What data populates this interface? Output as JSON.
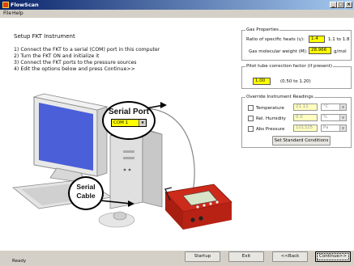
{
  "window": {
    "title": "FlowScan",
    "minimize": "_",
    "maximize": "□",
    "close": "×"
  },
  "menu": {
    "file": "File",
    "help": "Help"
  },
  "setup": {
    "heading": "Setup FKT Instrument",
    "steps": [
      "1) Connect the FKT to a serial (COM) port in this computer",
      "2) Turn the FKT ON and initialize it",
      "3) Connect the FKT ports to the pressure sources",
      "4) Edit the options below and press Continue>>"
    ]
  },
  "illustration": {
    "serial_port_label": "Serial Port",
    "com_port_value": "COM 1",
    "serial_cable_label_line1": "Serial",
    "serial_cable_label_line2": "Cable"
  },
  "gas_properties": {
    "title": "Gas Properties",
    "ratio_label": "Ratio of specific heats (γ):",
    "ratio_value": "1.4",
    "ratio_range": "1.1 to 1.8",
    "weight_label": "Gas molecular weight (M):",
    "weight_value": "28.966",
    "weight_unit": "g/mol"
  },
  "pitot": {
    "title": "Pitot tube correction factor (if present)",
    "value": "1.00",
    "range": "(0.50 to 1.20)"
  },
  "override": {
    "title": "Override Instrument Readings",
    "temperature_label": "Temperature",
    "temperature_value": "21.11",
    "temperature_unit": "°C",
    "humidity_label": "Rel. Humidity",
    "humidity_value": "0.0",
    "humidity_unit": "%",
    "pressure_label": "Abs Pressure",
    "pressure_value": "101325",
    "pressure_unit": "Pa",
    "set_standard_label": "Set Standard Conditions"
  },
  "bottom": {
    "status": "Ready",
    "startup": "Startup",
    "exit": "Exit",
    "back": "<<Back",
    "continue": "Continue>>"
  }
}
